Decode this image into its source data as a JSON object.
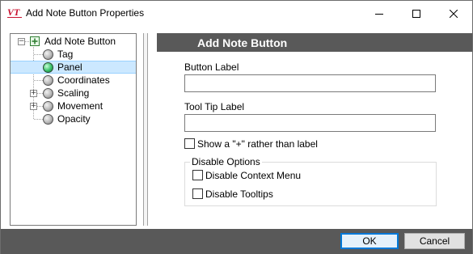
{
  "window": {
    "title": "Add Note Button Properties",
    "app_icon": "vt-logo-icon",
    "app_icon_text": "VT",
    "controls": [
      "minimize-icon",
      "maximize-icon",
      "close-icon"
    ]
  },
  "tree": {
    "root": {
      "label": "Add Note Button",
      "expanded": true
    },
    "items": [
      {
        "label": "Tag",
        "icon": "gray-sphere-icon",
        "expandable": false,
        "selected": false
      },
      {
        "label": "Panel",
        "icon": "green-sphere-icon",
        "expandable": false,
        "selected": true
      },
      {
        "label": "Coordinates",
        "icon": "gray-sphere-icon",
        "expandable": false,
        "selected": false
      },
      {
        "label": "Scaling",
        "icon": "gray-sphere-icon",
        "expandable": true,
        "selected": false
      },
      {
        "label": "Movement",
        "icon": "gray-sphere-icon",
        "expandable": true,
        "selected": false
      },
      {
        "label": "Opacity",
        "icon": "gray-sphere-icon",
        "expandable": false,
        "selected": false
      }
    ],
    "collapse_glyph": "−",
    "expand_glyph": "+"
  },
  "panel": {
    "header": "Add Note Button",
    "button_label": {
      "label": "Button Label",
      "value": ""
    },
    "tooltip_label": {
      "label": "Tool Tip Label",
      "value": ""
    },
    "show_plus": {
      "label": "Show a \"+\" rather than label",
      "checked": false
    },
    "disable_options": {
      "title": "Disable Options",
      "context_menu": {
        "label": "Disable Context Menu",
        "checked": false
      },
      "tooltips": {
        "label": "Disable Tooltips",
        "checked": false
      }
    }
  },
  "footer": {
    "ok_label": "OK",
    "cancel_label": "Cancel"
  },
  "colors": {
    "header_bg": "#595959",
    "footer_bg": "#595959",
    "selection_bg": "#cce8ff",
    "focus_border": "#0078d7",
    "logo_red": "#c8102e"
  }
}
